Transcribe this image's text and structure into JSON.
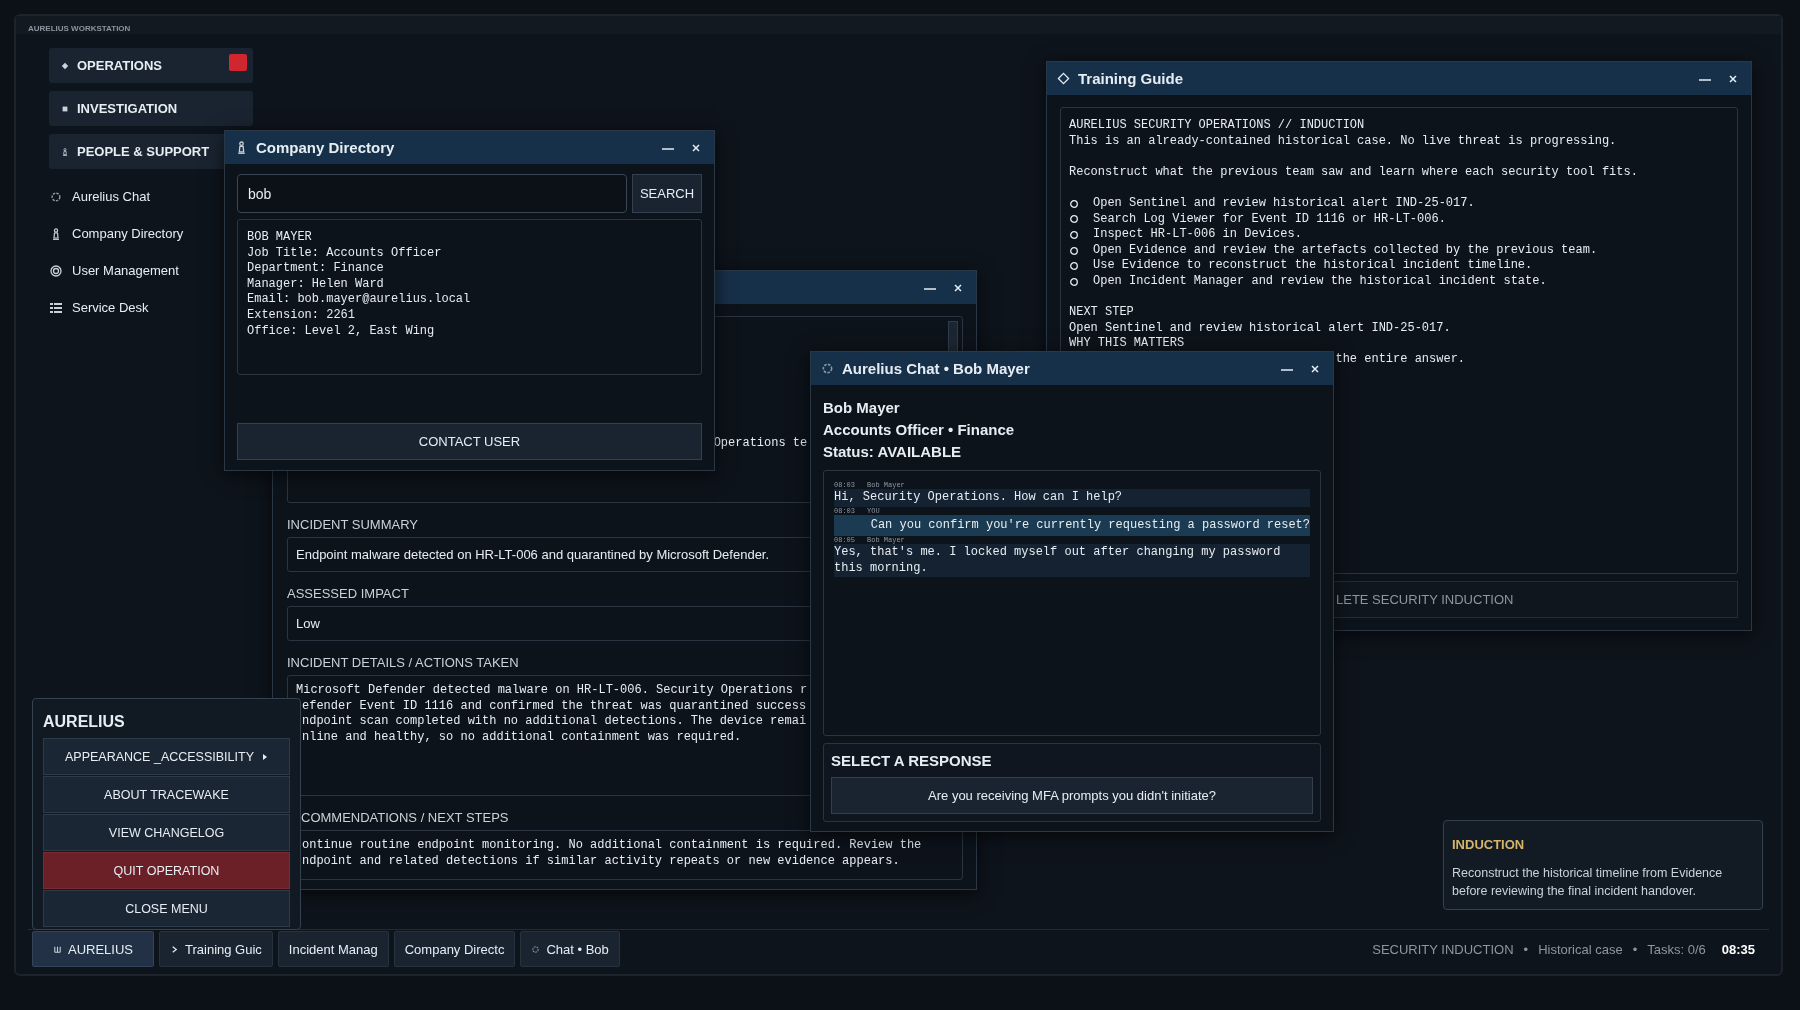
{
  "workstation": {
    "title": "AURELIUS WORKSTATION"
  },
  "sidebar": {
    "sections": [
      {
        "label": "OPERATIONS",
        "kind": "diamond",
        "alert": true
      },
      {
        "label": "INVESTIGATION",
        "kind": "square",
        "alert": false
      },
      {
        "label": "PEOPLE & SUPPORT",
        "kind": "pawn",
        "alert": false,
        "items": [
          {
            "label": "Aurelius Chat",
            "kind": "circle"
          },
          {
            "label": "Company Directory",
            "kind": "pawn"
          },
          {
            "label": "User Management",
            "kind": "target"
          },
          {
            "label": "Service Desk",
            "kind": "grid"
          }
        ]
      }
    ]
  },
  "incident_manager": {
    "notes_fragment": "Operations te",
    "fields": [
      {
        "label": "INCIDENT SUMMARY",
        "kind": "line",
        "value": "Endpoint malware detected on HR-LT-006 and quarantined by Microsoft Defender."
      },
      {
        "label": "ASSESSED IMPACT",
        "kind": "line",
        "value": "Low"
      },
      {
        "label": "INCIDENT DETAILS / ACTIONS TAKEN",
        "kind": "area",
        "lines": [
          "Microsoft Defender detected malware on HR-LT-006. Security Operations r",
          "efender Event ID 1116 and confirmed the threat was quarantined success",
          "ndpoint scan completed with no additional detections. The device remai",
          "nline and healthy, so no additional containment was required."
        ]
      },
      {
        "label": "COMMENDATIONS / NEXT STEPS",
        "kind": "area",
        "lines": [
          "ontinue routine endpoint monitoring. No additional containment is required. Review the",
          "ndpoint and related detections if similar activity repeats or new evidence appears."
        ]
      }
    ]
  },
  "training_guide": {
    "title": "Training Guide",
    "header_lines": [
      "AURELIUS SECURITY OPERATIONS // INDUCTION",
      "This is an already-contained historical case. No live threat is progressing."
    ],
    "intro": "Reconstruct what the previous team saw and learn where each security tool fits.",
    "tasks": [
      {
        "text": "Open Sentinel and review historical alert IND-25-017.",
        "done": false
      },
      {
        "text": "Search Log Viewer for Event ID 1116 or HR-LT-006.",
        "done": false
      },
      {
        "text": "Inspect HR-LT-006 in Devices.",
        "done": false
      },
      {
        "text": "Open Evidence and review the artefacts collected by the previous team.",
        "done": false
      },
      {
        "text": "Use Evidence to reconstruct the historical incident timeline.",
        "done": false
      },
      {
        "text": "Open Incident Manager and review the historical incident state.",
        "done": false
      }
    ],
    "next_step_label": "NEXT STEP",
    "next_step": "Open Sentinel and review historical alert IND-25-017.",
    "why_label": "WHY THIS MATTERS",
    "why_fragment": "the entire answer.",
    "button": "LETE SECURITY INDUCTION"
  },
  "company_directory": {
    "title": "Company Directory",
    "query": "bob",
    "search_button": "SEARCH",
    "result_lines": [
      "BOB MAYER",
      "Job Title: Accounts Officer",
      "Department: Finance",
      "Manager: Helen Ward",
      "Email: bob.mayer@aurelius.local",
      "Extension: 2261",
      "Office: Level 2, East Wing"
    ],
    "contact_button": "CONTACT USER"
  },
  "chat": {
    "title": "Aurelius Chat • Bob Mayer",
    "contact_name": "Bob Mayer",
    "contact_role": "Accounts Officer • Finance",
    "contact_status": "Status: AVAILABLE",
    "messages": [
      {
        "time": "08:03",
        "sender": "Bob Mayer",
        "kind": "incoming",
        "text": "Hi, Security Operations. How can I help?"
      },
      {
        "time": "08:03",
        "sender": "YOU",
        "kind": "outgoing",
        "text": "Can you confirm you're currently requesting a password reset?"
      },
      {
        "time": "08:05",
        "sender": "Bob Mayer",
        "kind": "incoming",
        "text": "Yes, that's me. I locked myself out after changing my password this morning."
      }
    ],
    "response_heading": "SELECT A RESPONSE",
    "responses": [
      "Are you receiving MFA prompts you didn't initiate?"
    ]
  },
  "start_menu": {
    "title": "AURELIUS",
    "items": [
      {
        "label": "APPEARANCE _ACCESSIBILITY",
        "kind": "submenu"
      },
      {
        "label": "ABOUT TRACEWAKE",
        "kind": "plain"
      },
      {
        "label": "VIEW CHANGELOG",
        "kind": "plain"
      },
      {
        "label": "QUIT OPERATION",
        "kind": "danger"
      },
      {
        "label": "CLOSE MENU",
        "kind": "plain"
      }
    ]
  },
  "induction_card": {
    "title": "INDUCTION",
    "text": "Reconstruct the historical timeline from Evidence before reviewing the final incident handover."
  },
  "taskbar": {
    "start": "AURELIUS",
    "tasks": [
      {
        "label": "Training Guic",
        "kind": "guide"
      },
      {
        "label": "Incident Manag",
        "kind": "plain"
      },
      {
        "label": "Company Directc",
        "kind": "plain"
      },
      {
        "label": "Chat • Bob",
        "kind": "chat"
      }
    ],
    "status": [
      "SECURITY INDUCTION",
      "•",
      "Historical case",
      "•",
      "Tasks: 0/6"
    ],
    "clock": "08:35"
  }
}
